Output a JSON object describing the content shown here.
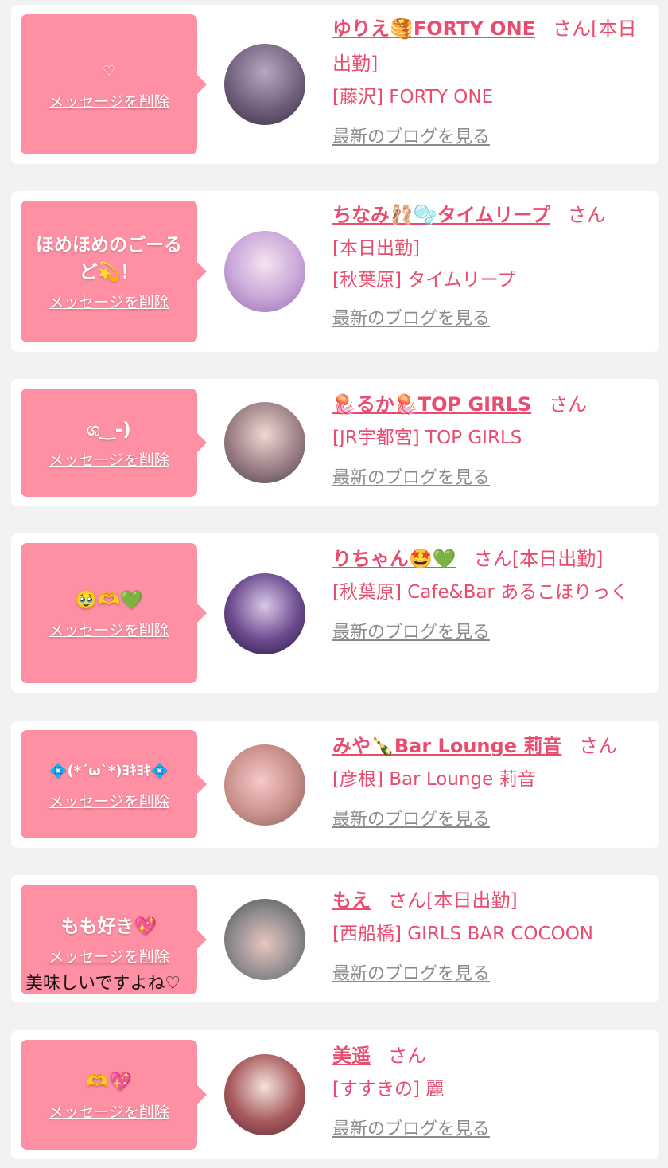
{
  "entries": [
    {
      "message": "♡",
      "delete_label": "メッセージを削除",
      "name": "ゆりえ🥞FORTY ONE",
      "suffix": "さん[本日出勤]",
      "shop": "[藤沢] FORTY ONE",
      "blog_label": "最新のブログを見る"
    },
    {
      "message": "ほめほめのごーるど💫！",
      "delete_label": "メッセージを削除",
      "name": "ちなみ🩰🫧タイムリープ",
      "suffix": "さん",
      "status": "[本日出勤]",
      "shop": "[秋葉原] タイムリープ",
      "blog_label": "最新のブログを見る"
    },
    {
      "message": "ශ‿-)",
      "delete_label": "メッセージを削除",
      "name": "🪼るか🪼TOP GIRLS",
      "suffix": "さん",
      "shop": "[JR宇都宮] TOP GIRLS",
      "blog_label": "最新のブログを見る"
    },
    {
      "message": "🥹🫶💚",
      "delete_label": "メッセージを削除",
      "name": "りちゃん🤩💚",
      "suffix": "さん[本日出勤]",
      "shop": "[秋葉原] Cafe&Bar あるこほりっく",
      "blog_label": "最新のブログを見る"
    },
    {
      "message": "💠(*´ω`*)ﾖｷﾖｷ💠",
      "delete_label": "メッセージを削除",
      "name": "みや🍾Bar Lounge 莉音",
      "suffix": "さん",
      "shop": "[彦根] Bar Lounge 莉音",
      "blog_label": "最新のブログを見る"
    },
    {
      "message": "もも好き💖",
      "delete_label": "メッセージを削除",
      "note": "美味しいですよね♡",
      "name": "もえ",
      "suffix": "さん[本日出勤]",
      "shop": "[西船橋] GIRLS BAR COCOON",
      "blog_label": "最新のブログを見る"
    },
    {
      "message": "🫶💖",
      "delete_label": "メッセージを削除",
      "name": "美遥",
      "suffix": "さん",
      "shop": "[すすきの] 麗",
      "blog_label": "最新のブログを見る"
    }
  ],
  "colors": {
    "accent": "#e94c6e",
    "bubble": "#ff8fa3",
    "background": "#f2f2f2",
    "card": "#ffffff",
    "link_gray": "#8a8a8a"
  }
}
